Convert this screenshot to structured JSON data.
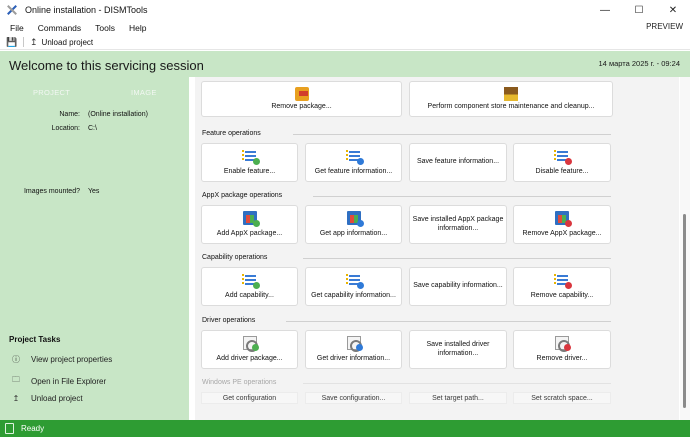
{
  "window": {
    "title": "Online installation - DISMTools",
    "controls": {
      "minimize": "—",
      "maximize": "☐",
      "close": "✕"
    }
  },
  "menu": {
    "items": [
      "File",
      "Commands",
      "Tools",
      "Help"
    ],
    "preview": "PREVIEW"
  },
  "toolbar": {
    "unload_label": "Unload project"
  },
  "header": {
    "welcome": "Welcome to this servicing session",
    "datetime": "14 марта 2025 г. - 09:24"
  },
  "sidebar": {
    "tabs": [
      "PROJECT",
      "IMAGE"
    ],
    "name_label": "Name:",
    "name_value": "(Online installation)",
    "location_label": "Location:",
    "location_value": "C:\\",
    "mounted_label": "Images mounted?",
    "mounted_value": "Yes",
    "tasks_title": "Project Tasks",
    "tasks": [
      "View project properties",
      "Open in File Explorer",
      "Unload project"
    ]
  },
  "content": {
    "top_tiles": [
      "Remove package...",
      "Perform component store maintenance and cleanup..."
    ],
    "sections": [
      {
        "title": "Feature operations",
        "tiles": [
          "Enable feature...",
          "Get feature information...",
          "Save feature information...",
          "Disable feature..."
        ]
      },
      {
        "title": "AppX package operations",
        "tiles": [
          "Add AppX package...",
          "Get app information...",
          "Save installed AppX package information...",
          "Remove AppX package..."
        ]
      },
      {
        "title": "Capability operations",
        "tiles": [
          "Add capability...",
          "Get capability information...",
          "Save capability information...",
          "Remove capability..."
        ]
      },
      {
        "title": "Driver operations",
        "tiles": [
          "Add driver package...",
          "Get driver information...",
          "Save installed driver information...",
          "Remove driver..."
        ]
      }
    ],
    "winpe": {
      "title": "Windows PE operations",
      "buttons": [
        "Get configuration",
        "Save configuration...",
        "Set target path...",
        "Set scratch space..."
      ]
    }
  },
  "status": {
    "text": "Ready"
  },
  "colors": {
    "accent_green": "#2e9c33",
    "panel_green": "#c8e6c6"
  }
}
